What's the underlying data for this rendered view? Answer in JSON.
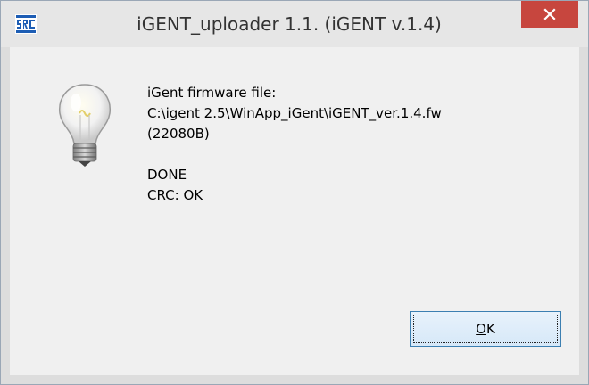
{
  "window": {
    "title": "iGENT_uploader 1.1. (iGENT v.1.4)",
    "app_icon": "app-logo-icon",
    "close_icon": "close-icon",
    "close_color": "#c7463e"
  },
  "message": {
    "icon": "lightbulb-icon",
    "lines": [
      "iGent firmware file:",
      "C:\\igent 2.5\\WinApp_iGent\\iGENT_ver.1.4.fw",
      "(22080B)",
      "",
      "DONE",
      "CRC: OK"
    ]
  },
  "buttons": {
    "ok_mnemonic": "O",
    "ok_rest": "K"
  }
}
